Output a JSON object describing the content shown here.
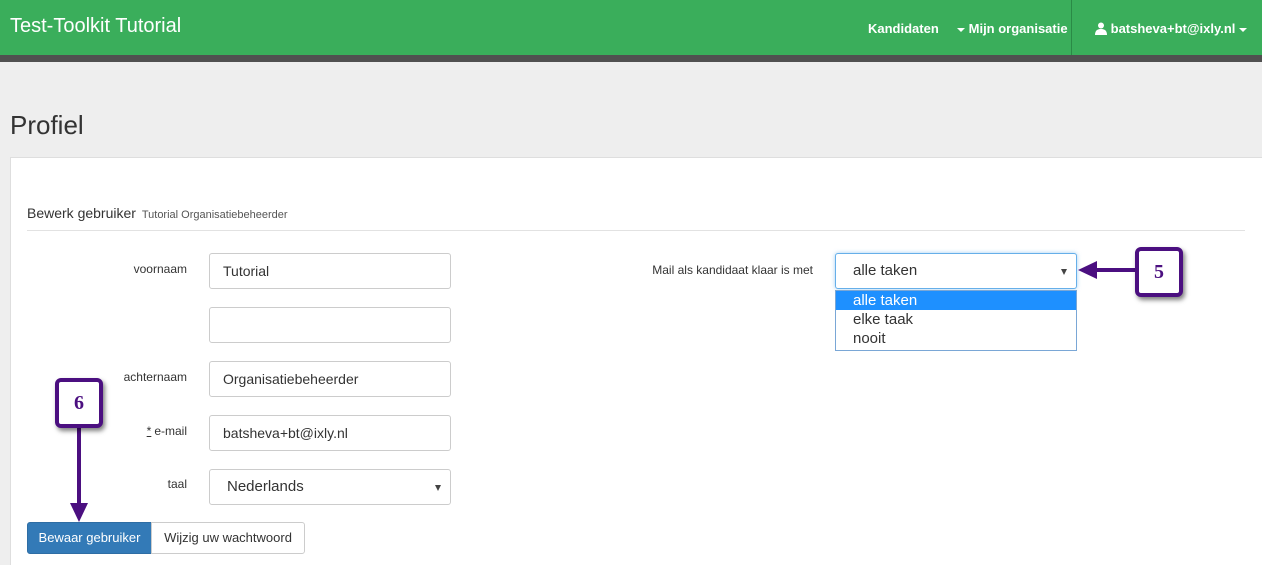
{
  "navbar": {
    "brand": "Test-Toolkit Tutorial",
    "links": {
      "candidates": "Kandidaten",
      "my_organization": "Mijn organisatie",
      "user": "batsheva+bt@ixly.nl"
    },
    "colors": {
      "bar": "#3aae5b",
      "strip": "#505050"
    }
  },
  "page": {
    "title": "Profiel"
  },
  "section": {
    "title": "Bewerk gebruiker",
    "subtitle": "Tutorial Organisatiebeheerder"
  },
  "form": {
    "first_name": {
      "label": "voornaam",
      "value": "Tutorial"
    },
    "middle_name": {
      "value": ""
    },
    "last_name": {
      "label": "achternaam",
      "value": "Organisatiebeheerder"
    },
    "email": {
      "required_mark": "*",
      "label": "e-mail",
      "value": "batsheva+bt@ixly.nl"
    },
    "language": {
      "label": "taal",
      "value": "Nederlands"
    },
    "mail_when_done": {
      "label": "Mail als kandidaat klaar is met",
      "value": "alle taken",
      "options": [
        "alle taken",
        "elke taak",
        "nooit"
      ],
      "active_option_index": 0
    }
  },
  "buttons": {
    "save": "Bewaar gebruiker",
    "change_password": "Wijzig uw wachtwoord"
  },
  "annotations": {
    "badge_5": "5",
    "badge_6": "6",
    "color": "#4b0f80"
  }
}
